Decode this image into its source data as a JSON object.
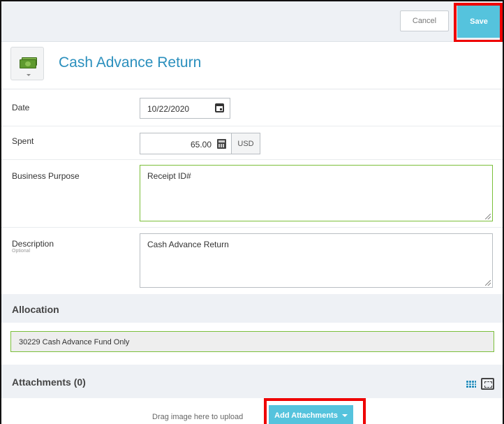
{
  "toolbar": {
    "cancel_label": "Cancel",
    "save_label": "Save"
  },
  "header": {
    "title": "Cash Advance Return",
    "type_icon": "money-icon"
  },
  "form": {
    "date": {
      "label": "Date",
      "value": "10/22/2020"
    },
    "spent": {
      "label": "Spent",
      "value": "65.00",
      "currency": "USD"
    },
    "business_purpose": {
      "label": "Business Purpose",
      "value": "Receipt ID#"
    },
    "description": {
      "label": "Description",
      "sublabel": "Optional",
      "value": "Cash Advance Return"
    }
  },
  "allocation": {
    "title": "Allocation",
    "value": "30229 Cash Advance Fund Only"
  },
  "attachments": {
    "title": "Attachments",
    "count": "(0)",
    "drag_text": "Drag image here to upload",
    "add_label": "Add Attachments"
  },
  "colors": {
    "accent": "#55c3dd",
    "title": "#2a8fbd",
    "valid_border": "#7bbf3a",
    "highlight": "#ee0000"
  }
}
